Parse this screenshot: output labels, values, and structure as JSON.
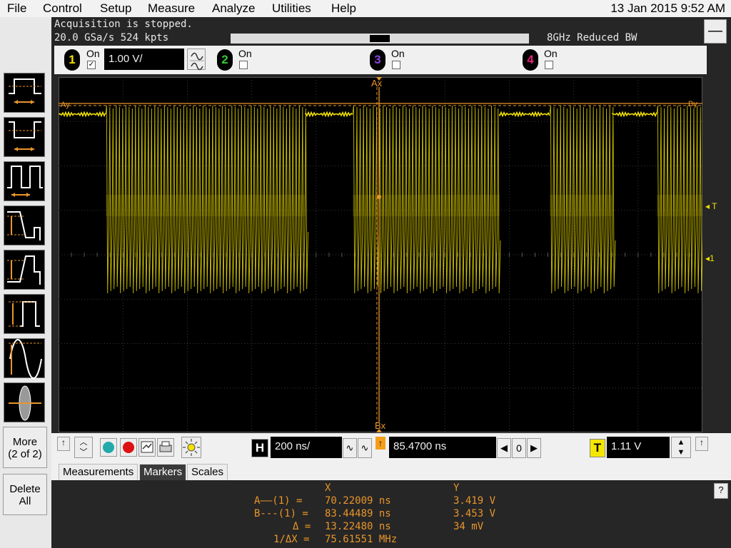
{
  "menu": [
    "File",
    "Control",
    "Setup",
    "Measure",
    "Analyze",
    "Utilities",
    "Help"
  ],
  "datetime": "13 Jan 2015  9:52 AM",
  "acquisition": {
    "status": "Acquisition is stopped.",
    "rate_line": "20.0 GSa/s   524 kpts",
    "bandwidth": "8GHz Reduced BW"
  },
  "channels": [
    {
      "num": "1",
      "on_label": "On",
      "checked": true,
      "color": "#f0e000"
    },
    {
      "num": "2",
      "on_label": "On",
      "checked": false,
      "color": "#33cc33"
    },
    {
      "num": "3",
      "on_label": "On",
      "checked": false,
      "color": "#8a44dd"
    },
    {
      "num": "4",
      "on_label": "On",
      "checked": false,
      "color": "#e8207a"
    }
  ],
  "vertical_scale": "1.00 V/",
  "left_toolbar": {
    "more": "More\n(2 of 2)",
    "delete_all": "Delete\nAll",
    "icons": [
      "pulse-width-positive-icon",
      "pulse-width-negative-icon",
      "period-icon",
      "fall-time-icon",
      "rise-time-icon",
      "amplitude-icon",
      "sine-peak-icon",
      "ac-rms-icon"
    ]
  },
  "scope": {
    "marker_ax": "Ax",
    "marker_bx": "Bx",
    "marker_ay": "Ay",
    "marker_by": "By",
    "trigger_label": "T",
    "ch1_label": "1"
  },
  "bottom": {
    "h_label": "H",
    "timebase": "200 ns/",
    "delay": "85.4700 ns",
    "zero": "0",
    "t_label": "T",
    "trigger_level": "1.11 V"
  },
  "tabs": [
    "Measurements",
    "Markers",
    "Scales"
  ],
  "selected_tab": "Markers",
  "marker_table": {
    "x_header": "X",
    "y_header": "Y",
    "rows": [
      {
        "label": "A——(1) =",
        "x": "70.22009 ns",
        "y": "3.419 V"
      },
      {
        "label": "B---(1) =",
        "x": "83.44489 ns",
        "y": "3.453 V"
      },
      {
        "label": "Δ =",
        "x": "13.22480 ns",
        "y": "34 mV"
      },
      {
        "label": "1/ΔX =",
        "x": "75.61551 MHz",
        "y": ""
      }
    ]
  },
  "help_button": "?",
  "colors": {
    "trace": "#f0e000",
    "marker": "#e8952a",
    "grid": "#3a3a3a"
  }
}
